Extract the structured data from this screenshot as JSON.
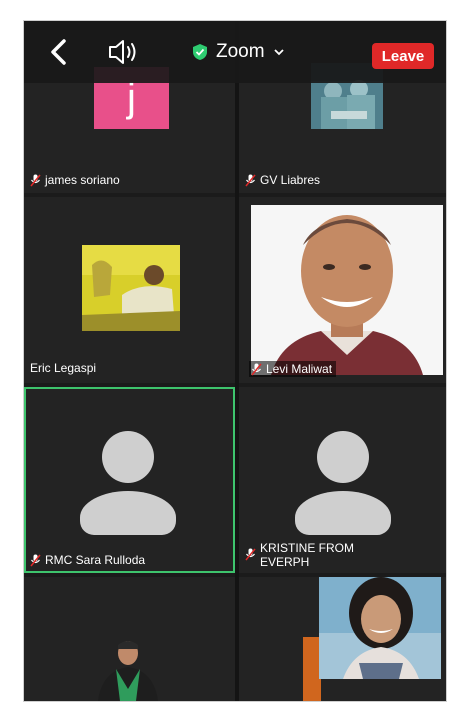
{
  "header": {
    "title": "Zoom",
    "leave_label": "Leave"
  },
  "tiles": [
    {
      "name": "james soriano",
      "initial": "j",
      "muted": true
    },
    {
      "name": "GV Liabres",
      "muted": true
    },
    {
      "name": "Eric Legaspi",
      "muted": false
    },
    {
      "name": "Levi Maliwat",
      "muted": true
    },
    {
      "name": "RMC Sara Rulloda",
      "muted": true
    },
    {
      "name": "KRISTINE FROM EVERPH",
      "muted": true
    }
  ],
  "colors": {
    "leave": "#e02828",
    "active_speaker_border": "#3ec46d",
    "initial_avatar": "#e8508a",
    "shield": "#2ecc71"
  },
  "icons": [
    "back-chevron-icon",
    "speaker-icon",
    "shield-check-icon",
    "chevron-down-icon",
    "muted-mic-icon",
    "person-placeholder-icon"
  ]
}
